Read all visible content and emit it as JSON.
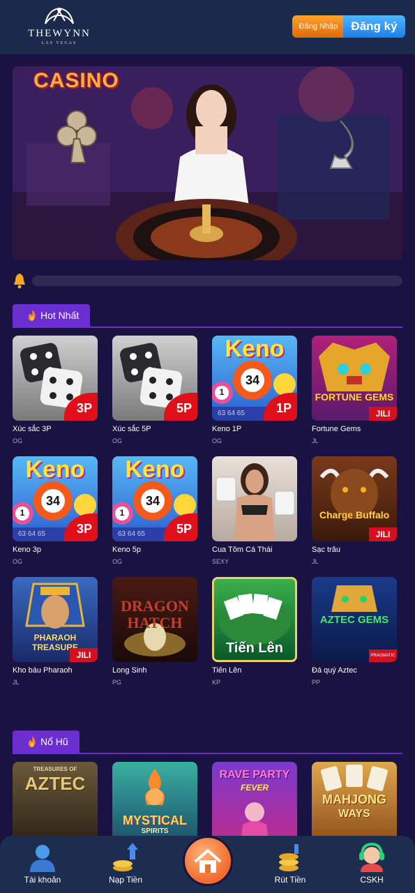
{
  "header": {
    "logo_brand": "THEWYNN",
    "logo_sub": "LAS VEGAS",
    "login_label": "Đăng Nhập",
    "register_label": "Đăng ký"
  },
  "banner": {
    "word": "CASINO"
  },
  "sections": [
    {
      "title": "Hot Nhất",
      "games": [
        {
          "name": "Xúc sắc 3P",
          "provider": "OG",
          "badge": "3P"
        },
        {
          "name": "Xúc sắc 5P",
          "provider": "OG",
          "badge": "5P"
        },
        {
          "name": "Keno 1P",
          "provider": "OG",
          "badge": "1P",
          "thumb_text": "Keno",
          "ball_number": "34",
          "ball_small": "1",
          "row_text": "63 64 65"
        },
        {
          "name": "Fortune Gems",
          "provider": "JL",
          "thumb_text": "FORTUNE GEMS",
          "badge": "JILI"
        },
        {
          "name": "Keno 3p",
          "provider": "OG",
          "badge": "3P",
          "thumb_text": "Keno",
          "ball_number": "34",
          "ball_small": "1",
          "row_text": "63 64 65"
        },
        {
          "name": "Keno 5p",
          "provider": "OG",
          "badge": "5P",
          "thumb_text": "Keno",
          "ball_number": "34",
          "ball_small": "1",
          "row_text": "63 64 65"
        },
        {
          "name": "Cua Tôm Cá Thái",
          "provider": "SEXY"
        },
        {
          "name": "Sạc trâu",
          "provider": "JL",
          "thumb_text": "Charge Buffalo",
          "badge": "JILI"
        },
        {
          "name": "Kho báu Pharaoh",
          "provider": "JL",
          "thumb_text": "PHARAOH TREASURE",
          "badge": "JILI"
        },
        {
          "name": "Long Sinh",
          "provider": "PG",
          "thumb_text": "DRAGON HATCH"
        },
        {
          "name": "Tiến Lên",
          "provider": "KP",
          "thumb_text": "Tiến Lên"
        },
        {
          "name": "Đá quý Aztec",
          "provider": "PP",
          "thumb_text": "AZTEC GEMS",
          "badge": "PRAGMATIC PLAY"
        }
      ]
    },
    {
      "title": "Nổ Hũ",
      "games": [
        {
          "thumb_text": "AZTEC",
          "thumb_sub": "TREASURES OF"
        },
        {
          "thumb_text": "MYSTICAL",
          "thumb_sub": "SPIRITS"
        },
        {
          "thumb_text": "RAVE PARTY",
          "thumb_sub": "FEVER"
        },
        {
          "thumb_text": "MAHJONG",
          "thumb_sub": "WAYS"
        }
      ]
    }
  ],
  "bottom_nav": [
    {
      "label": "Tài khoản"
    },
    {
      "label": "Nạp Tiền"
    },
    {
      "label": "Rút Tiền"
    },
    {
      "label": "CSKH"
    }
  ],
  "colors": {
    "background": "#1a1240",
    "header": "#1b2a4a",
    "accent_purple": "#6b2ed0",
    "login_orange": "#f08a16",
    "register_blue": "#2e8ff0",
    "badge_red": "#e0101a"
  },
  "icons": {
    "bell": "bell-icon",
    "fire": "fire-icon",
    "home": "home-icon",
    "account": "user-icon",
    "deposit": "deposit-icon",
    "withdraw": "withdraw-icon",
    "support": "support-icon"
  }
}
